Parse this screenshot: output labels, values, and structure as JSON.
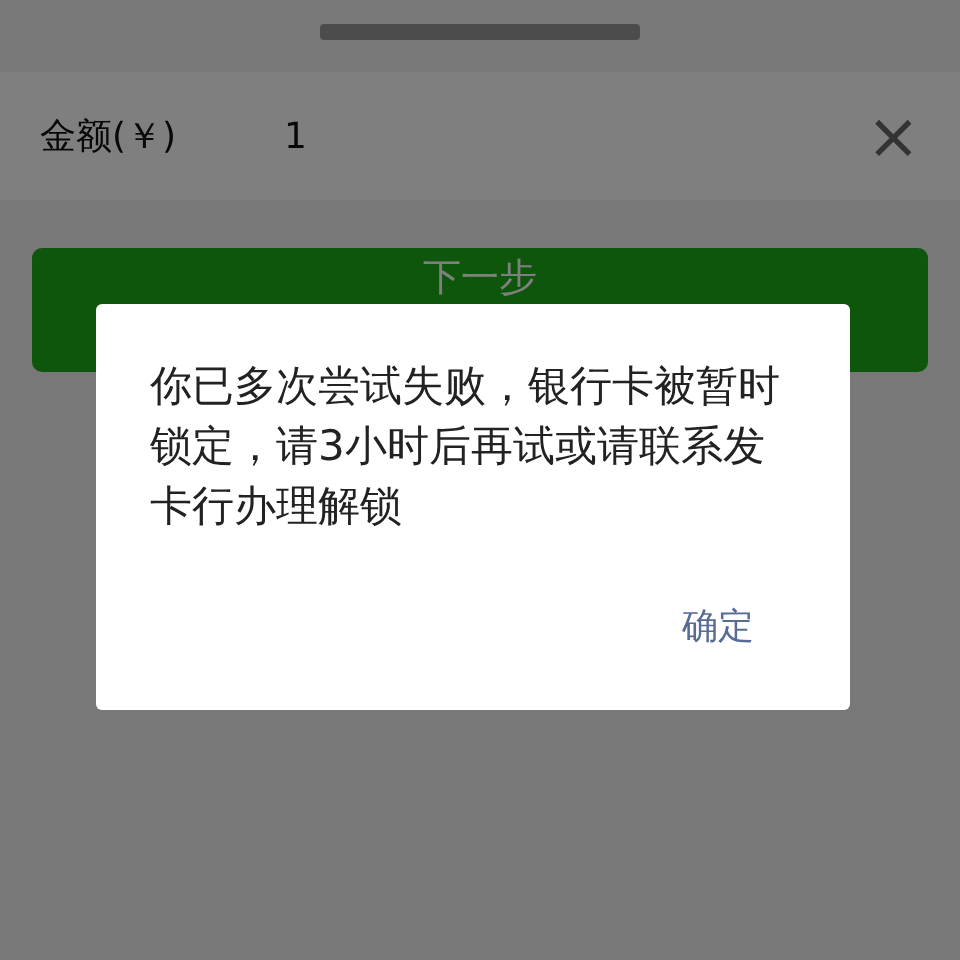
{
  "amount": {
    "label": "金额(￥)",
    "value": "1",
    "clear": "×"
  },
  "next_button": "下一步",
  "dialog": {
    "message": "你已多次尝试失败，银行卡被暂时锁定，请3小时后再试或请联系发卡行办理解锁",
    "buttons": [
      "确定"
    ]
  }
}
